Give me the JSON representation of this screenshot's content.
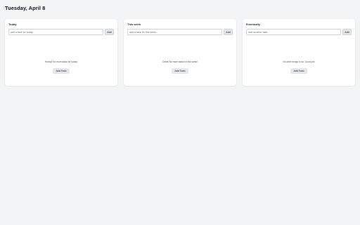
{
  "page": {
    "title": "Tuesday, April 8"
  },
  "columns": [
    {
      "title": "Today",
      "input_placeholder": "add a task for today...",
      "add_button": "Add",
      "empty_message": "Hurray! No more tasks for today!",
      "add_todo_button": "Add Todo"
    },
    {
      "title": "This week",
      "input_placeholder": "add a task for this week...",
      "add_button": "Add",
      "empty_message": "Great! No more tasks for this week!",
      "add_todo_button": "Add Todo"
    },
    {
      "title": "Eventually",
      "input_placeholder": "Add another task...",
      "add_button": "Add",
      "empty_message": "No other things to do. Good job!",
      "add_todo_button": "Add Todo"
    }
  ]
}
